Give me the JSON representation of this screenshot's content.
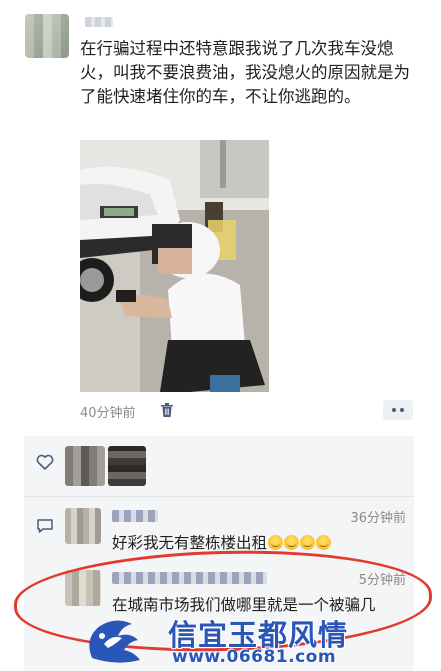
{
  "post": {
    "text": "在行骗过程中还特意跟我说了几次我车没熄火，叫我不要浪费油，我没熄火的原因就是为了能快速堵住你的车，不让你逃跑的。",
    "time": "40分钟前"
  },
  "comments": [
    {
      "time": "36分钟前",
      "text": "好彩我无有整栋楼出租"
    },
    {
      "time": "5分钟前",
      "text": "在城南市场我们做哪里就是一个被骗几"
    }
  ],
  "watermark": {
    "title": "信宜玉都风情",
    "url": "www.06681.com"
  },
  "colors": {
    "accent": "#4c5b82",
    "highlight": "#e23b2e",
    "watermark": "#2a56b8"
  }
}
